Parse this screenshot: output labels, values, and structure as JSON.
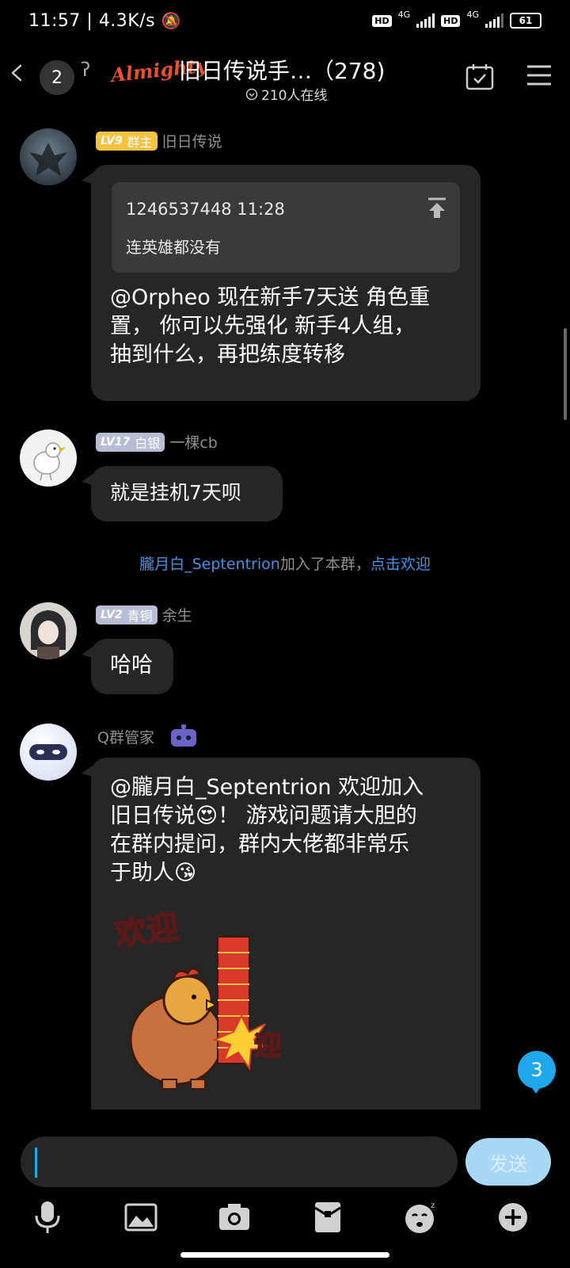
{
  "status_bar": {
    "time": "11:57",
    "net_speed": "4.3K/s",
    "hd1": "HD",
    "net1": "4G",
    "hd2": "HD",
    "net2": "4G",
    "battery": "61"
  },
  "header": {
    "unread_count": "2",
    "logo_text": "Almighty",
    "title": "旧日传说手…（278)",
    "online": "210人在线"
  },
  "messages": [
    {
      "level": "LV9",
      "role": "群主",
      "sender": "旧日传说",
      "quote": {
        "header": "1246537448 11:28",
        "text": "连英雄都没有"
      },
      "lines": [
        "@Orpheo 现在新手7天送 角色重",
        "置， 你可以先强化 新手4人组，",
        "抽到什么，再把练度转移"
      ]
    },
    {
      "level": "LV17",
      "role": "白银",
      "sender": "一棵cb",
      "text": "就是挂机7天呗"
    },
    {
      "level": "LV2",
      "role": "青铜",
      "sender": "余生",
      "text": "哈哈"
    },
    {
      "sender": "Q群管家",
      "lines": [
        "@朧月白_Septentrion 欢迎加入",
        "旧日传说😍！ 游戏问题请大胆的",
        "在群内提问，群内大佬都非常乐",
        "于助人😘"
      ],
      "sticker_text_top": "欢迎",
      "sticker_text_side": "迎"
    }
  ],
  "system_note": {
    "name": "朧月白_Septentrion",
    "middle": "加入了本群，",
    "action": "点击欢迎"
  },
  "unread_bubble": "3",
  "input": {
    "send_label": "发送"
  },
  "colors": {
    "accent": "#1ea7ea",
    "link": "#4a8fe0",
    "owner_tag": "#f5c242",
    "silver_tag": "#b8bdd6",
    "bubble": "#262626"
  }
}
